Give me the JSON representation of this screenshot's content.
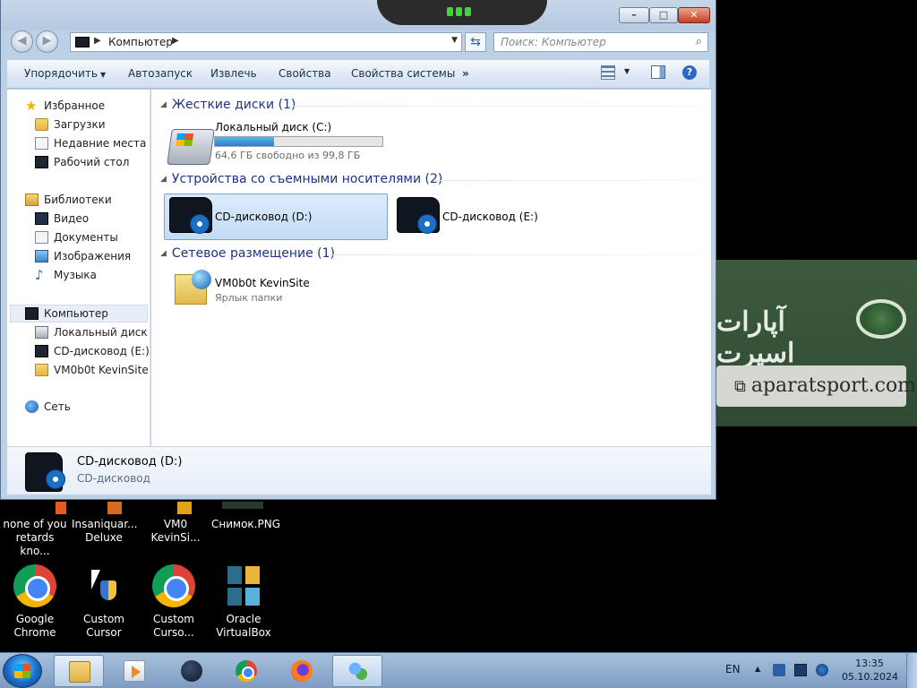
{
  "background_brand": {
    "fa_text": "آپارات اسپرت",
    "url_text": "aparatsport.com"
  },
  "desktop_icons": {
    "row1": [
      {
        "label": "none of you retards kno...",
        "icon": "file-icon"
      },
      {
        "label": "Insaniquar... Deluxe",
        "icon": "file-icon"
      },
      {
        "label": "VM0 KevinSi...",
        "icon": "shortcut-icon"
      },
      {
        "label": "Снимок.PNG",
        "icon": "image-icon"
      }
    ],
    "row2": [
      {
        "label": "Google Chrome",
        "icon": "chrome-icon"
      },
      {
        "label": "Custom Cursor",
        "icon": "cursor-icon"
      },
      {
        "label": "Custom Curso...",
        "icon": "chrome-icon"
      },
      {
        "label": "Oracle VirtualBox",
        "icon": "virtualbox-icon"
      }
    ]
  },
  "window": {
    "address": {
      "location": "Компьютер"
    },
    "search": {
      "placeholder": "Поиск: Компьютер"
    },
    "toolbar": {
      "organize": "Упорядочить",
      "autoplay": "Автозапуск",
      "eject": "Извлечь",
      "properties": "Свойства",
      "system_properties": "Свойства системы",
      "more": "»"
    },
    "sidebar": {
      "favorites": "Избранное",
      "downloads": "Загрузки",
      "recent": "Недавние места",
      "desktop": "Рабочий стол",
      "libraries": "Библиотеки",
      "video": "Видео",
      "documents": "Документы",
      "pictures": "Изображения",
      "music": "Музыка",
      "computer": "Компьютер",
      "local_disk": "Локальный диск (C",
      "cd_e": "CD-дисковод (E:)",
      "vm_site": "VM0b0t KevinSite",
      "network": "Сеть"
    },
    "groups": {
      "hard_drives": "Жесткие диски (1)",
      "removable": "Устройства со съемными носителями (2)",
      "network_locations": "Сетевое размещение (1)"
    },
    "items": {
      "local_disk": {
        "name": "Локальный диск (C:)",
        "free": "64,6 ГБ свободно из 99,8 ГБ",
        "used_fraction": 0.353
      },
      "cd_d": {
        "name": "CD-дисковод (D:)"
      },
      "cd_e": {
        "name": "CD-дисковод (E:)"
      },
      "vm_site": {
        "name": "VM0b0t KevinSite",
        "type": "Ярлык папки"
      }
    },
    "details": {
      "name": "CD-дисковод (D:)",
      "type": "CD-дисковод"
    }
  },
  "taskbar": {
    "lang": "EN",
    "time": "13:35",
    "date": "05.10.2024",
    "pinned": [
      "explorer-icon",
      "media-player-icon",
      "app-icon",
      "chrome-icon",
      "firefox-icon",
      "users-icon"
    ]
  }
}
